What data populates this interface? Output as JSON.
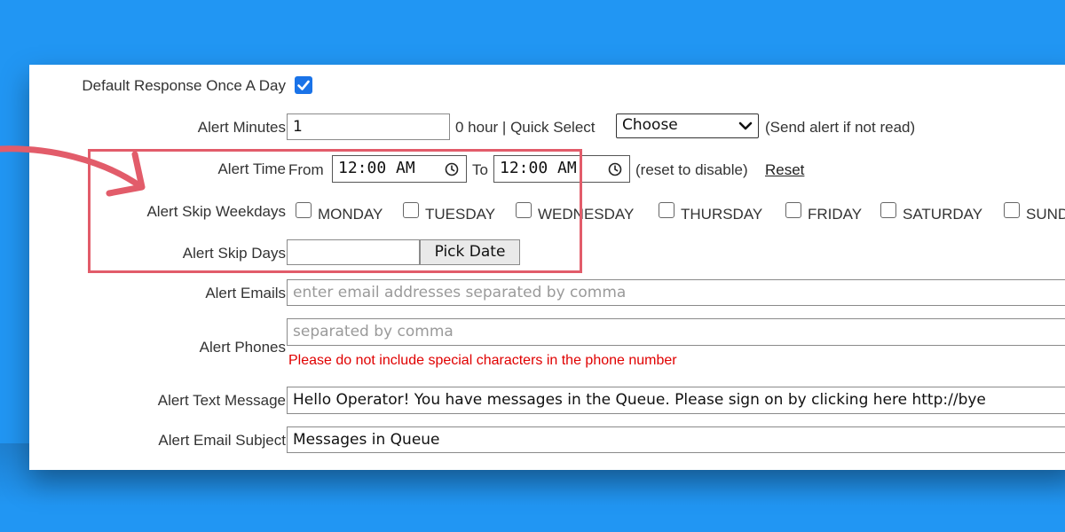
{
  "form": {
    "default_response": {
      "label": "Default Response Once A Day",
      "checked": true
    },
    "alert_minutes": {
      "label": "Alert Minutes",
      "value": "1",
      "hours_text": "0 hour | Quick Select",
      "select_value": "Choose",
      "note": "(Send alert if not read)"
    },
    "alert_time": {
      "label": "Alert Time",
      "from_label": "From",
      "from_value": "12:00 AM",
      "to_label": "To",
      "to_value": "12:00 AM",
      "note": "(reset to disable)",
      "reset_label": "Reset"
    },
    "skip_weekdays": {
      "label": "Alert Skip Weekdays",
      "days": [
        "MONDAY",
        "TUESDAY",
        "WEDNESDAY",
        "THURSDAY",
        "FRIDAY",
        "SATURDAY",
        "SUNDAY"
      ]
    },
    "skip_days": {
      "label": "Alert Skip Days",
      "value": "",
      "button_label": "Pick Date"
    },
    "alert_emails": {
      "label": "Alert Emails",
      "placeholder": "enter email addresses separated by comma"
    },
    "alert_phones": {
      "label": "Alert Phones",
      "placeholder": "separated by comma",
      "warning": "Please do not include special characters in the phone number"
    },
    "alert_text_message": {
      "label": "Alert Text Message",
      "value": "Hello Operator! You have messages in the Queue. Please sign on by clicking here http://bye"
    },
    "alert_email_subject": {
      "label": "Alert Email Subject",
      "value": "Messages in Queue"
    }
  },
  "colors": {
    "background": "#2196f3",
    "highlight": "#e25c6a",
    "checkbox_checked": "#1a73e8",
    "warning": "#e00000"
  },
  "icons": {
    "time": "clock-icon",
    "select": "chevron-down-icon",
    "annotation": "curved-arrow-icon"
  }
}
